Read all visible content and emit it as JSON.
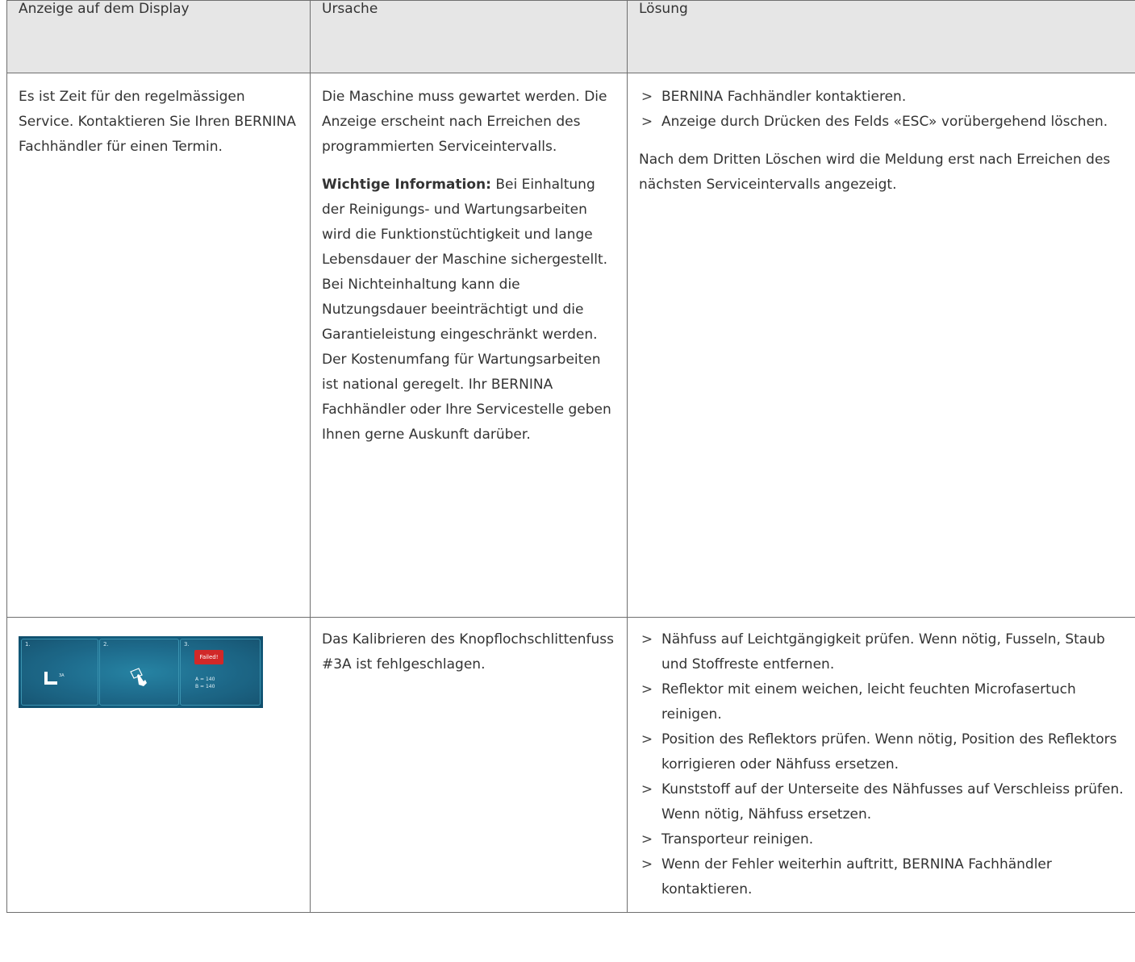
{
  "headers": [
    "Anzeige auf dem Display",
    "Ursache",
    "Lösung"
  ],
  "bullet": ">",
  "row1": {
    "display_text": "Es ist Zeit für den regelmässigen Service. Kontaktieren Sie Ihren BERNINA Fachhändler für einen Termin.",
    "cause_text": "Die Maschine muss gewartet werden. Die Anzeige erscheint nach Erreichen des programmierten Serviceintervalls.",
    "cause_note_label": "Wichtige Information:",
    "cause_note_text": " Bei Einhaltung der Reinigungs- und Wartungsarbeiten wird die Funktionstüchtigkeit und lange Lebensdauer der Maschine sichergestellt. Bei Nichteinhaltung kann die Nutzungsdauer beeinträchtigt und die Garantieleistung eingeschränkt werden. Der Kostenumfang für Wartungsarbeiten ist national geregelt. Ihr BERNINA Fachhändler oder Ihre Servicestelle geben Ihnen gerne Auskunft darüber.",
    "solution_steps": [
      "BERNINA Fachhändler kontaktieren.",
      "Anzeige durch Drücken des Felds «ESC» vorübergehend löschen."
    ],
    "solution_note": "Nach dem Dritten Löschen wird die Meldung erst nach Erreichen des nächsten Serviceintervalls angezeigt."
  },
  "row2": {
    "screen": {
      "panel_numbers": [
        "1.",
        "2.",
        "3."
      ],
      "failed_label": "Failed!",
      "value_a": "A = 140",
      "value_b": "B = 140",
      "foot_label": "3A",
      "colors": {
        "background": "#17688a",
        "failed": "#d12828"
      },
      "icons": [
        "presser-foot-icon",
        "touch-hand-icon"
      ]
    },
    "cause_text": "Das Kalibrieren des Knopflochschlittenfuss #3A ist fehlgeschlagen.",
    "solution_steps": [
      "Nähfuss auf Leichtgängigkeit prüfen. Wenn nötig, Fusseln, Staub und Stoffreste entfernen.",
      "Reflektor mit einem weichen, leicht feuchten Microfasertuch reinigen.",
      "Position des Reflektors prüfen. Wenn nötig, Position des Reflektors korrigieren oder Nähfuss ersetzen.",
      "Kunststoff auf der Unterseite des Nähfusses auf Verschleiss prüfen. Wenn nötig, Nähfuss ersetzen.",
      "Transporteur reinigen.",
      "Wenn der Fehler weiterhin auftritt, BERNINA Fachhändler kontaktieren."
    ]
  }
}
